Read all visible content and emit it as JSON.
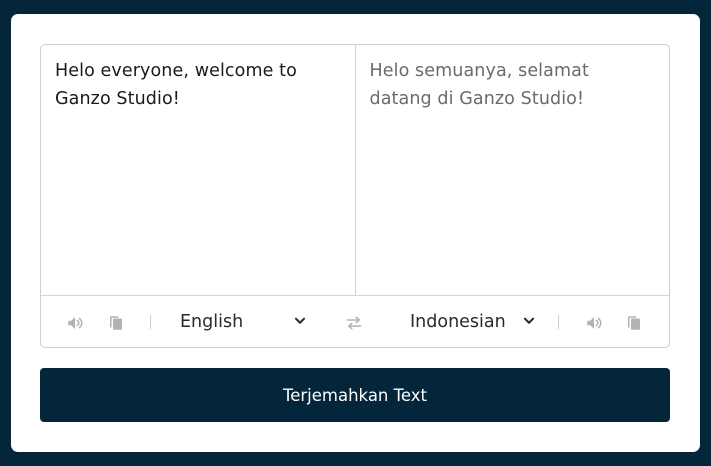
{
  "source": {
    "text": "Helo everyone, welcome to Ganzo Studio!"
  },
  "target": {
    "text": "Helo semuanya, selamat datang di Ganzo Studio!"
  },
  "controls": {
    "source_language": "English",
    "target_language": "Indonesian",
    "icons": [
      "speaker-icon",
      "copy-icon",
      "chevron-down-icon",
      "swap-icon"
    ]
  },
  "actions": {
    "translate_label": "Terjemahkan Text"
  },
  "colors": {
    "background": "#04263a",
    "card": "#ffffff",
    "button": "#04263a",
    "icon": "#b0b0b0"
  }
}
